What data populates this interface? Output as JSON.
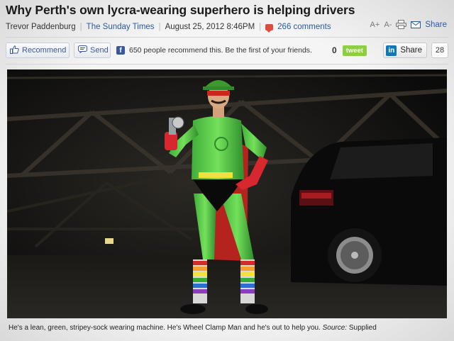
{
  "article": {
    "headline": "Why Perth's own lycra-wearing superhero is helping drivers",
    "author": "Trevor Paddenburg",
    "publication": "The Sunday Times",
    "date": "August 25, 2012 8:46PM",
    "comments": "266 comments"
  },
  "tools": {
    "font_increase": "A+",
    "font_decrease": "A-",
    "print_icon": "printer-icon",
    "share_label": "Share"
  },
  "social": {
    "recommend_label": "Recommend",
    "send_label": "Send",
    "fb_text": "650 people recommend this. Be the first of your friends.",
    "tweet_count": "0",
    "tweet_label": "tweet",
    "linkedin_label": "Share",
    "linkedin_count": "28"
  },
  "caption": {
    "text": "He's a lean, green, stripey-sock wearing machine. He's Wheel Clamp Man and he's out to help you.",
    "source_label": "Source:",
    "source_value": "Supplied"
  },
  "colors": {
    "link": "#2b5aa3",
    "facebook": "#3b5998",
    "tweet": "#8ccf3f",
    "linkedin": "#0f77b5"
  }
}
